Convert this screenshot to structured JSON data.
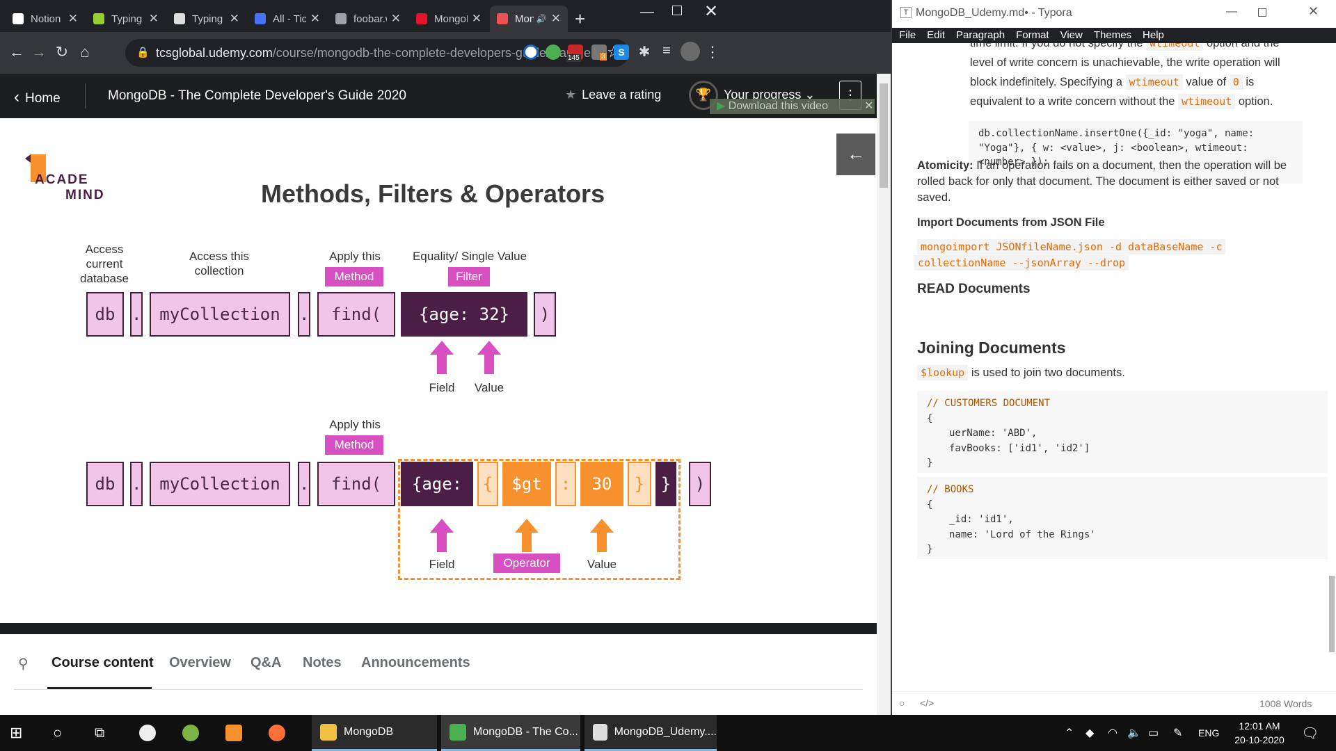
{
  "browser": {
    "tabs": [
      {
        "label": "Notion Ic",
        "icon": "notion-icon",
        "color": "#ffffff"
      },
      {
        "label": "Typing Te",
        "icon": "typing-test-icon",
        "color": "#9acd32"
      },
      {
        "label": "Typing pr",
        "icon": "document-icon",
        "color": "#dddddd"
      },
      {
        "label": "All - Tick",
        "icon": "ticktick-icon",
        "color": "#4772fa"
      },
      {
        "label": "foobar.w",
        "icon": "globe-icon",
        "color": "#9aa0a6"
      },
      {
        "label": "MongoD",
        "icon": "opera-icon",
        "color": "#e0152d"
      },
      {
        "label": "Mon",
        "icon": "udemy-icon",
        "color": "#ec5252"
      }
    ],
    "url_host": "tcsglobal.udemy.com",
    "url_path": "/course/mongodb-the-complete-developers-guide/learn/le..."
  },
  "extensions": {
    "badge_145": "145",
    "badge_3": "3"
  },
  "udemy": {
    "home": "Home",
    "course_title": "MongoDB - The Complete Developer's Guide 2020",
    "leave_rating": "Leave a rating",
    "your_progress": "Your progress",
    "download_video": "Download this video",
    "tabs": [
      "Course content",
      "Overview",
      "Q&A",
      "Notes",
      "Announcements"
    ]
  },
  "slide": {
    "logo_line1": "ACADE",
    "logo_line2": "MIND",
    "title": "Methods, Filters & Operators",
    "row1": {
      "label_db": "Access current database",
      "label_collection": "Access this collection",
      "label_method": "Apply this",
      "tag_method": "Method",
      "label_filter": "Equality/ Single Value",
      "tag_filter": "Filter",
      "db": "db",
      "dot": ".",
      "collection": "myCollection",
      "find": "find(",
      "filter": "{age: 32}",
      "close": ")",
      "field": "Field",
      "value": "Value"
    },
    "row2": {
      "label_method": "Apply this",
      "tag_method": "Method",
      "db": "db",
      "dot": ".",
      "collection": "myCollection",
      "find": "find(",
      "age": "{age:",
      "lbrace": "{",
      "op": "$gt",
      "colon": ":",
      "val": "30",
      "rbrace": "}",
      "rbrace2": "}",
      "close": ")",
      "field": "Field",
      "operator": "Operator",
      "value": "Value"
    }
  },
  "typora": {
    "window_title": "MongoDB_Udemy.md• - Typora",
    "menu": [
      "File",
      "Edit",
      "Paragraph",
      "Format",
      "View",
      "Themes",
      "Help"
    ],
    "p1_top": "time limit. If you do not specify the",
    "p1_top_code": "wtimeout",
    "p1_top_end": "option and the",
    "p1_l2": "level of write concern is unachievable, the write operation will",
    "p1_l3a": "block indefinitely. Specifying a",
    "p1_l3_code": "wtimeout",
    "p1_l3b": "value of",
    "p1_l3_code2": "0",
    "p1_l3c": "is",
    "p1_l4a": "equivalent to a write concern without the",
    "p1_l4_code": "wtimeout",
    "p1_l4b": "option.",
    "code1_l1": "db.collectionName.insertOne({_id: \"yoga\", name:",
    "code1_l2": "\"Yoga\"}, { w: <value>, j: <boolean>, wtimeout:",
    "code1_l3": "<number> });",
    "atom_bold": "Atomicity:",
    "atom_l1": "If an operation fails on a document, then the operation will be",
    "atom_l2": "rolled back for only that document. The document is either saved or not",
    "atom_l3": "saved.",
    "import_heading": "Import Documents from JSON File",
    "import_code1": "mongoimport JSONfileName.json -d dataBaseName -c",
    "import_code2": "collectionName --jsonArray --drop",
    "read_heading": "READ Documents",
    "join_heading": "Joining Documents",
    "lookup_code": "$lookup",
    "lookup_text": "is used to join two documents.",
    "cust_comment": "// CUSTOMERS DOCUMENT",
    "cust_open": "{",
    "cust_l1": "uerName: 'ABD',",
    "cust_l2": "favBooks: ['id1', 'id2']",
    "cust_close": "}",
    "books_comment": "// BOOKS",
    "books_open": "{",
    "books_l1": "_id: 'id1',",
    "books_l2": "name: 'Lord of the Rings'",
    "books_close": "}",
    "word_count": "1008 Words"
  },
  "taskbar": {
    "apps": [
      {
        "label": "MongoDB",
        "icon": "folder-icon",
        "color": "#f0c040"
      },
      {
        "label": "MongoDB - The Co...",
        "icon": "chrome-icon",
        "color": "#4caf50"
      },
      {
        "label": "MongoDB_Udemy....",
        "icon": "typora-icon",
        "color": "#dddddd"
      }
    ],
    "lang": "ENG",
    "time": "12:01 AM",
    "date": "20-10-2020"
  }
}
